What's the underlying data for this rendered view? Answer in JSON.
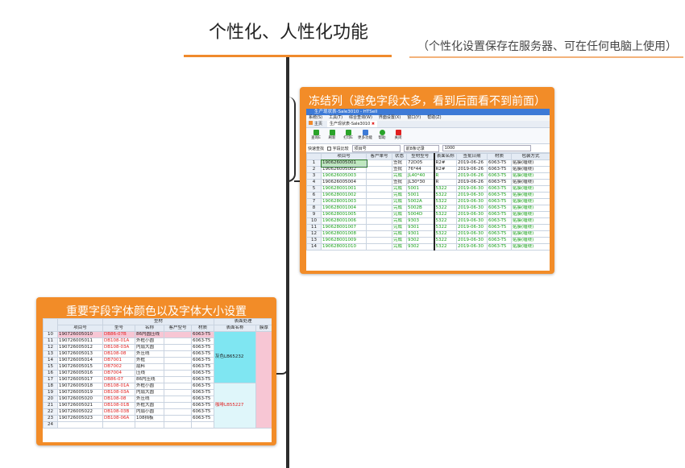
{
  "title": "个性化、人性化功能",
  "note": "（个性化设置保存在服务器、可在任何电脑上使用）",
  "card1": {
    "title": "冻结列（避免字段太多，看到后面看不到前面）",
    "window_title": "生产现状表-Sale3010 - HTSell",
    "menu": [
      "系统(S)",
      "工具(T)",
      "综合查询(W)",
      "界面设置(X)",
      "窗口(Y)",
      "帮助(Z)"
    ],
    "tab": "生产现状表-Sale3010",
    "home": "主页",
    "toolbar": [
      "查询E",
      "刷新",
      "打印E",
      "更多功能",
      "帮助",
      "关闭"
    ],
    "filter": {
      "label": "快速查找",
      "checkbox": "字段比较",
      "field": "项目号",
      "mode": "前8条记录",
      "limit": "1000"
    },
    "headers": [
      "项目号",
      "客户单号",
      "状态",
      "型材型号",
      "表面名称",
      "签批日期",
      "材质",
      "包装方式"
    ],
    "rows": [
      [
        "1",
        "190626005001",
        "",
        "签批",
        "72D05",
        "R2#",
        "2019-06-26",
        "6063-T5",
        "贴膜(缠绕)"
      ],
      [
        "2",
        "190626005002",
        "",
        "签批",
        "76*44",
        "R2#",
        "2019-06-26",
        "6063-T5",
        "贴膜(缠绕)"
      ],
      [
        "3",
        "190626005003",
        "",
        "完成",
        "JL40*40",
        "R",
        "2019-06-26",
        "6063-T5",
        "贴膜(缠绕)"
      ],
      [
        "4",
        "190626005004",
        "",
        "签批",
        "JL30*30",
        "R",
        "2019-06-26",
        "6063-T5",
        "贴膜(缠绕)"
      ],
      [
        "5",
        "190628001001",
        "",
        "完成",
        "5001",
        "5322",
        "2019-06-30",
        "6063-T5",
        "贴膜(缠绕)"
      ],
      [
        "6",
        "190628001002",
        "",
        "完成",
        "5001",
        "5322",
        "2019-06-30",
        "6063-T5",
        "贴膜(缠绕)"
      ],
      [
        "7",
        "190628001003",
        "",
        "完成",
        "5002A",
        "5322",
        "2019-06-30",
        "6063-T5",
        "贴膜(缠绕)"
      ],
      [
        "8",
        "190628001004",
        "",
        "完成",
        "5002B",
        "5322",
        "2019-06-30",
        "6063-T5",
        "贴膜(缠绕)"
      ],
      [
        "9",
        "190628001005",
        "",
        "完成",
        "5004D",
        "5322",
        "2019-06-30",
        "6063-T5",
        "贴膜(缠绕)"
      ],
      [
        "10",
        "190628001006",
        "",
        "完成",
        "9303",
        "5322",
        "2019-06-30",
        "6063-T5",
        "贴膜(缠绕)"
      ],
      [
        "11",
        "190628001007",
        "",
        "完成",
        "9301",
        "5322",
        "2019-06-30",
        "6063-T5",
        "贴膜(缠绕)"
      ],
      [
        "12",
        "190628001008",
        "",
        "完成",
        "9301",
        "5322",
        "2019-06-30",
        "6063-T5",
        "贴膜(缠绕)"
      ],
      [
        "13",
        "190628001009",
        "",
        "完成",
        "9302",
        "5322",
        "2019-06-30",
        "6063-T5",
        "贴膜(缠绕)"
      ],
      [
        "14",
        "190628001010",
        "",
        "完成",
        "9302",
        "5322",
        "2019-06-30",
        "6063-T5",
        "贴膜(缠绕)"
      ]
    ]
  },
  "card2": {
    "title": "重要字段字体颜色以及字体大小设置",
    "group1": "型材",
    "group2": "表面处理",
    "headers": [
      "项目号",
      "型号",
      "名称",
      "客户型号",
      "材质",
      "表面名称",
      "膜厚"
    ],
    "rows": [
      [
        "10",
        "190726005010",
        "DB86-07B",
        "86内圆压线",
        "",
        "6063-T5"
      ],
      [
        "11",
        "190726005011",
        "DB108-01A",
        "外框小圆",
        "",
        "6063-T5"
      ],
      [
        "12",
        "190726005012",
        "DB108-03A",
        "内扇大圆",
        "",
        "6063-T5"
      ],
      [
        "13",
        "190726005013",
        "DB108-08",
        "外压线",
        "",
        "6063-T5"
      ],
      [
        "14",
        "190726005014",
        "DB7001",
        "外框",
        "",
        "6063-T5"
      ],
      [
        "15",
        "190726005015",
        "DB7002",
        "扇料",
        "",
        "6063-T5"
      ],
      [
        "16",
        "190726005016",
        "DB7004",
        "压线",
        "",
        "6063-T5"
      ],
      [
        "17",
        "190726005017",
        "DB86-07",
        "86内压线",
        "",
        "6063-T5"
      ],
      [
        "18",
        "190726005018",
        "DB108-01A",
        "外框小圆",
        "",
        "6063-T5"
      ],
      [
        "19",
        "190726005019",
        "DB108-03A",
        "内扇大圆",
        "",
        "6063-T5"
      ],
      [
        "20",
        "190726005020",
        "DB108-08",
        "外压线",
        "",
        "6063-T5"
      ],
      [
        "21",
        "190726005021",
        "DB108-01B",
        "外框大圆",
        "",
        "6063-T5"
      ],
      [
        "22",
        "190726005022",
        "DB108-03B",
        "内扇小圆",
        "",
        "6063-T5"
      ],
      [
        "23",
        "190726005023",
        "DB108-06A",
        "108挡板",
        "",
        "6063-T5"
      ],
      [
        "24",
        "",
        "",
        "",
        "",
        ""
      ]
    ],
    "surface1": "灰色LB65232",
    "surface2": "咖啡LB55227"
  }
}
